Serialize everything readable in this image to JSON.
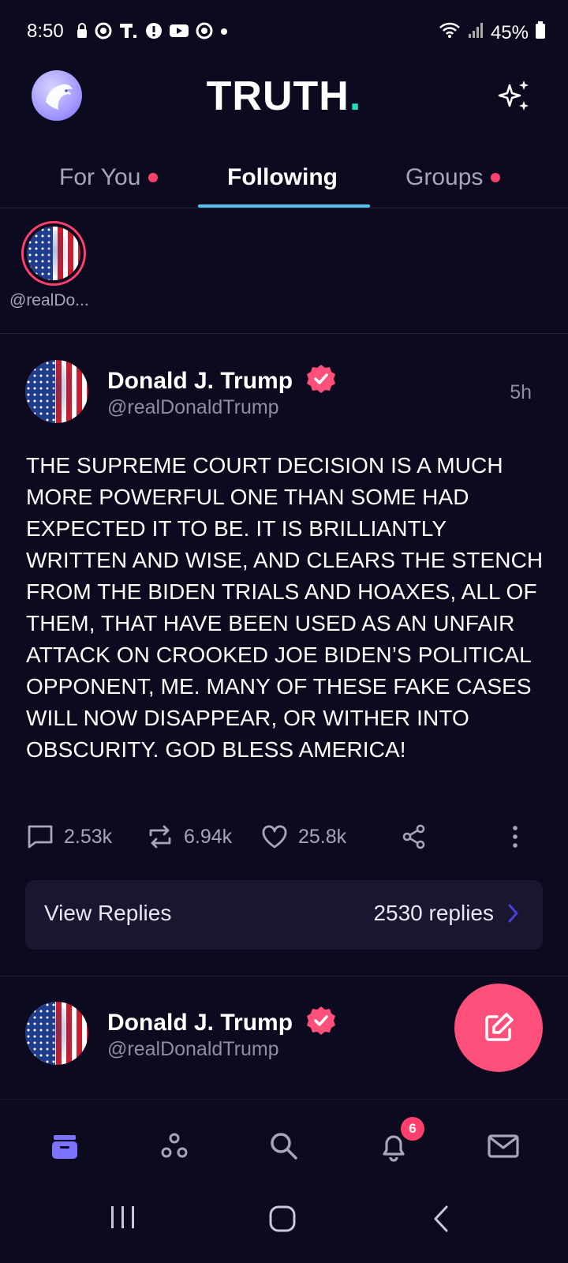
{
  "status_bar": {
    "time": "8:50",
    "battery": "45%"
  },
  "header": {
    "logo_text": "TRUTH",
    "logo_dot": ".",
    "accent_color": "#20e0c0"
  },
  "tabs": [
    {
      "label": "For You",
      "active": false,
      "dot": true
    },
    {
      "label": "Following",
      "active": true,
      "dot": false
    },
    {
      "label": "Groups",
      "active": false,
      "dot": true
    }
  ],
  "stories": [
    {
      "label": "@realDo..."
    }
  ],
  "post": {
    "name": "Donald J. Trump",
    "handle": "@realDonaldTrump",
    "time": "5h",
    "body": "THE SUPREME COURT DECISION IS A MUCH MORE POWERFUL ONE THAN SOME HAD EXPECTED IT TO BE. IT IS BRILLIANTLY WRITTEN AND WISE, AND CLEARS THE STENCH FROM THE BIDEN TRIALS AND HOAXES, ALL OF THEM, THAT HAVE BEEN USED AS AN UNFAIR ATTACK ON CROOKED JOE BIDEN’S POLITICAL OPPONENT, ME. MANY OF THESE FAKE CASES WILL NOW DISAPPEAR, OR WITHER INTO OBSCURITY. GOD BLESS AMERICA!",
    "replies_count": "2.53k",
    "retruths_count": "6.94k",
    "likes_count": "25.8k",
    "view_replies_label": "View Replies",
    "replies_label": "2530 replies"
  },
  "next_post": {
    "name": "Donald J. Trump",
    "handle": "@realDonaldTrump"
  },
  "bottom_nav": {
    "notifications_badge": "6",
    "active_color": "#7b73ff"
  },
  "colors": {
    "background": "#0c0a1e",
    "brand_pink": "#ff4f7b",
    "tab_underline": "#4ec1ef"
  }
}
